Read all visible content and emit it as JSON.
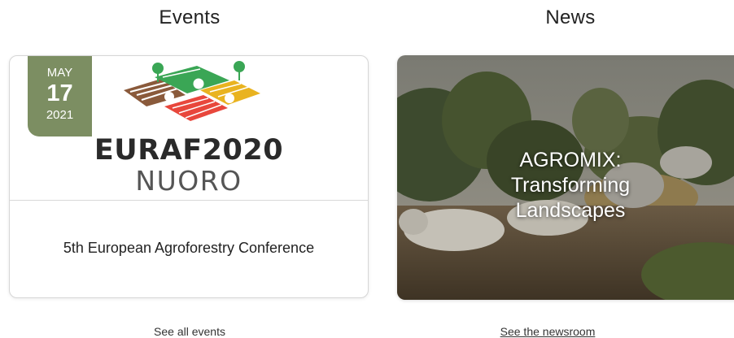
{
  "events": {
    "heading": "Events",
    "card": {
      "date": {
        "month": "MAY",
        "day": "17",
        "year": "2021"
      },
      "logo_title": "EURAF2020",
      "logo_subtitle": "NUORO",
      "title": "5th European Agroforestry Conference"
    },
    "link_label": "See all events"
  },
  "news": {
    "heading": "News",
    "card": {
      "title": "AGROMIX: Transforming Landscapes"
    },
    "link_label": "See the newsroom"
  },
  "colors": {
    "date_badge": "#7c8e62",
    "logo_green": "#3aa655",
    "logo_red": "#e8473c",
    "logo_yellow": "#e9b320",
    "logo_brown": "#8a5a3b"
  }
}
